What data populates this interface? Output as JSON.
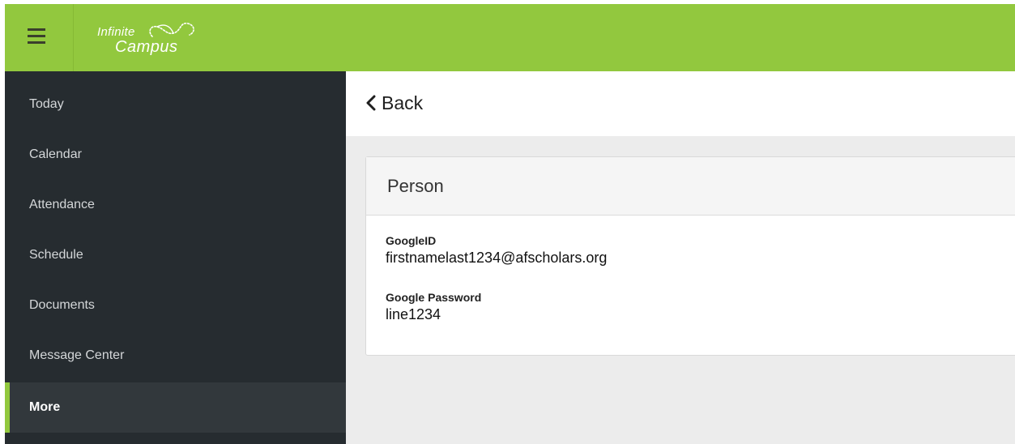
{
  "header": {
    "logo_line1": "Infinite",
    "logo_line2": "Campus",
    "accent_color": "#92c83e"
  },
  "menu_icon": "hamburger-menu-icon",
  "sidebar": {
    "items": [
      {
        "label": "Today"
      },
      {
        "label": "Calendar"
      },
      {
        "label": "Attendance"
      },
      {
        "label": "Schedule"
      },
      {
        "label": "Documents"
      },
      {
        "label": "Message Center"
      },
      {
        "label": "More",
        "active": true
      }
    ]
  },
  "main": {
    "back_label": "Back",
    "back_icon": "chevron-left-icon",
    "card": {
      "title": "Person",
      "fields": [
        {
          "label": "GoogleID",
          "value": "firstnamelast1234@afscholars.org"
        },
        {
          "label": "Google Password",
          "value": "line1234"
        }
      ]
    }
  }
}
